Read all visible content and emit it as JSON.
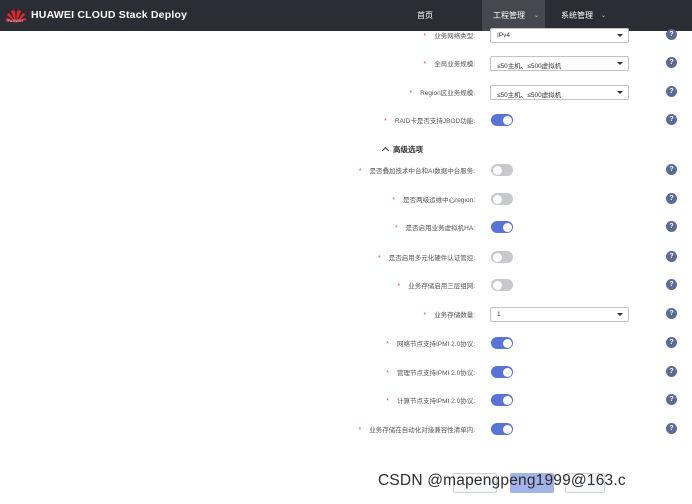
{
  "app": {
    "logo_text": "HUAWEI",
    "title": "HUAWEI CLOUD Stack Deploy"
  },
  "nav": {
    "home": "首页",
    "project": "工程管理",
    "system": "系统管理"
  },
  "rows": [
    {
      "label": "业务网络类型:",
      "type": "select",
      "value": "IPv4"
    },
    {
      "label": "全局业务规模:",
      "type": "select",
      "value": "≤50主机、≤500虚拟机"
    },
    {
      "label": "Region区业务规模:",
      "type": "select",
      "value": "≤50主机、≤500虚拟机"
    },
    {
      "label": "RAID卡是否支持JBOD功能:",
      "type": "toggle",
      "on": true
    }
  ],
  "advanced": {
    "title": "高级选项",
    "rows": [
      {
        "label": "是否叠加技术中台和AI数据中台服务:",
        "type": "toggle",
        "on": false
      },
      {
        "label": "是否两级运维中心region:",
        "type": "toggle",
        "on": false
      },
      {
        "label": "是否启用业务虚拟机HA:",
        "type": "toggle",
        "on": true
      },
      {
        "label": "是否启用多元化硬件认证管控:",
        "type": "toggle",
        "on": false
      },
      {
        "label": "业务存储启用三层组网:",
        "type": "toggle",
        "on": false
      },
      {
        "label": "业务存储数量:",
        "type": "select",
        "value": "1"
      },
      {
        "label": "网络节点支持IPMI 2.0协议:",
        "type": "toggle",
        "on": true
      },
      {
        "label": "管理节点支持IPMI 2.0协议:",
        "type": "toggle",
        "on": true
      },
      {
        "label": "计算节点支持IPMI 2.0协议:",
        "type": "toggle",
        "on": true
      },
      {
        "label": "业务存储在自动化对接兼容性清单内:",
        "type": "toggle",
        "on": true
      }
    ]
  },
  "help_icon": "?",
  "watermark": "CSDN @mapengpeng1999@163.c",
  "colors": {
    "topbar": "#2b2d35",
    "accent": "#5a73d8",
    "required": "#e84a4a",
    "help": "#5b6b95"
  }
}
